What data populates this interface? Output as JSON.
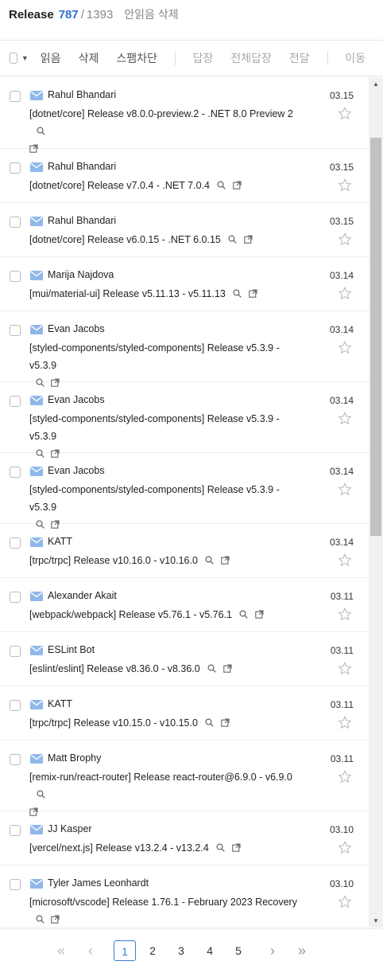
{
  "header": {
    "title": "Release",
    "count": "787",
    "slash": "/",
    "total": "1393",
    "delete_unread": "안읽음 삭제"
  },
  "toolbar": {
    "read": "읽음",
    "delete": "삭제",
    "block_spam": "스팸차단",
    "reply": "답장",
    "reply_all": "전체답장",
    "forward": "전달",
    "move": "이동"
  },
  "mails": [
    {
      "sender": "Rahul Bhandari",
      "date": "03.15",
      "subject": "[dotnet/core] Release v8.0.0-preview.2 - .NET 8.0 Preview 2"
    },
    {
      "sender": "Rahul Bhandari",
      "date": "03.15",
      "subject": "[dotnet/core] Release v7.0.4 - .NET 7.0.4"
    },
    {
      "sender": "Rahul Bhandari",
      "date": "03.15",
      "subject": "[dotnet/core] Release v6.0.15 - .NET 6.0.15"
    },
    {
      "sender": "Marija Najdova",
      "date": "03.14",
      "subject": "[mui/material-ui] Release v5.11.13 - v5.11.13"
    },
    {
      "sender": "Evan Jacobs",
      "date": "03.14",
      "subject": "[styled-components/styled-components] Release v5.3.9 - v5.3.9"
    },
    {
      "sender": "Evan Jacobs",
      "date": "03.14",
      "subject": "[styled-components/styled-components] Release v5.3.9 - v5.3.9"
    },
    {
      "sender": "Evan Jacobs",
      "date": "03.14",
      "subject": "[styled-components/styled-components] Release v5.3.9 - v5.3.9"
    },
    {
      "sender": "KATT",
      "date": "03.14",
      "subject": "[trpc/trpc] Release v10.16.0 - v10.16.0"
    },
    {
      "sender": "Alexander Akait",
      "date": "03.11",
      "subject": "[webpack/webpack] Release v5.76.1 - v5.76.1"
    },
    {
      "sender": "ESLint Bot",
      "date": "03.11",
      "subject": "[eslint/eslint] Release v8.36.0 - v8.36.0"
    },
    {
      "sender": "KATT",
      "date": "03.11",
      "subject": "[trpc/trpc] Release v10.15.0 - v10.15.0"
    },
    {
      "sender": "Matt Brophy",
      "date": "03.11",
      "subject": "[remix-run/react-router] Release react-router@6.9.0 - v6.9.0"
    },
    {
      "sender": "JJ Kasper",
      "date": "03.10",
      "subject": "[vercel/next.js] Release v13.2.4 - v13.2.4"
    },
    {
      "sender": "Tyler James Leonhardt",
      "date": "03.10",
      "subject": "[microsoft/vscode] Release 1.76.1 - February 2023 Recovery"
    }
  ],
  "pagination": {
    "first": "«",
    "prev": "‹",
    "pages": [
      "1",
      "2",
      "3",
      "4",
      "5"
    ],
    "current": "1",
    "next": "›",
    "last": "»"
  },
  "colors": {
    "accent": "#2f6fd3",
    "envelope": "#8fb8ea",
    "star": "#bdbdbd"
  }
}
